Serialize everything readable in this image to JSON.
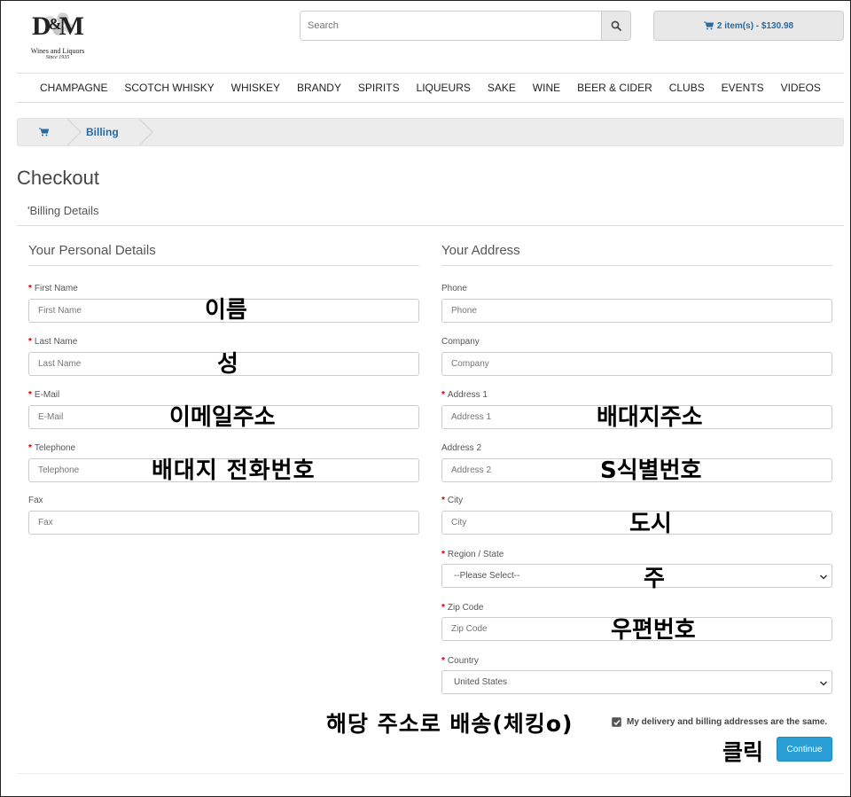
{
  "brand": {
    "logo_text_left": "D",
    "logo_amp": "&",
    "logo_text_right": "M",
    "tagline": "Wines and Liquors",
    "since": "Since 1935"
  },
  "search": {
    "placeholder": "Search"
  },
  "cart": {
    "label": "2 item(s) - $130.98"
  },
  "nav": [
    "CHAMPAGNE",
    "SCOTCH WHISKY",
    "WHISKEY",
    "BRANDY",
    "SPIRITS",
    "LIQUEURS",
    "SAKE",
    "WINE",
    "BEER & CIDER",
    "CLUBS",
    "EVENTS",
    "VIDEOS"
  ],
  "breadcrumb": {
    "current": "Billing"
  },
  "page_title": "Checkout",
  "section_title": "'Billing Details",
  "personal": {
    "legend": "Your Personal Details",
    "fields": [
      {
        "label": "First Name",
        "required": "*",
        "placeholder": "First Name"
      },
      {
        "label": "Last Name",
        "required": "*",
        "placeholder": "Last Name"
      },
      {
        "label": "E-Mail",
        "required": "*",
        "placeholder": "E-Mail"
      },
      {
        "label": "Telephone",
        "required": "*",
        "placeholder": "Telephone"
      },
      {
        "label": "Fax",
        "required": "",
        "placeholder": "Fax"
      }
    ]
  },
  "address": {
    "legend": "Your Address",
    "fields": [
      {
        "label": "Phone",
        "required": "",
        "placeholder": "Phone"
      },
      {
        "label": "Company",
        "required": "",
        "placeholder": "Company"
      },
      {
        "label": "Address 1",
        "required": "*",
        "placeholder": "Address 1"
      },
      {
        "label": "Address 2",
        "required": "",
        "placeholder": "Address 2"
      },
      {
        "label": "City",
        "required": "*",
        "placeholder": "City"
      },
      {
        "label": "Region / State",
        "required": "*",
        "value": "--Please Select--"
      },
      {
        "label": "Zip Code",
        "required": "*",
        "placeholder": "Zip Code"
      },
      {
        "label": "Country",
        "required": "*",
        "value": "United States"
      }
    ]
  },
  "same_address": {
    "label": "My delivery and billing addresses are the same.",
    "checked": true
  },
  "continue_label": "Continue",
  "annotations": {
    "first_name": "이름",
    "last_name": "성",
    "email": "이메일주소",
    "telephone": "배대지 전화번호",
    "address1": "배대지주소",
    "address2": "S식별번호",
    "city": "도시",
    "state": "주",
    "zip": "우편번호",
    "same_address": "해당 주소로 배송(체킹o)",
    "click": "클릭"
  }
}
